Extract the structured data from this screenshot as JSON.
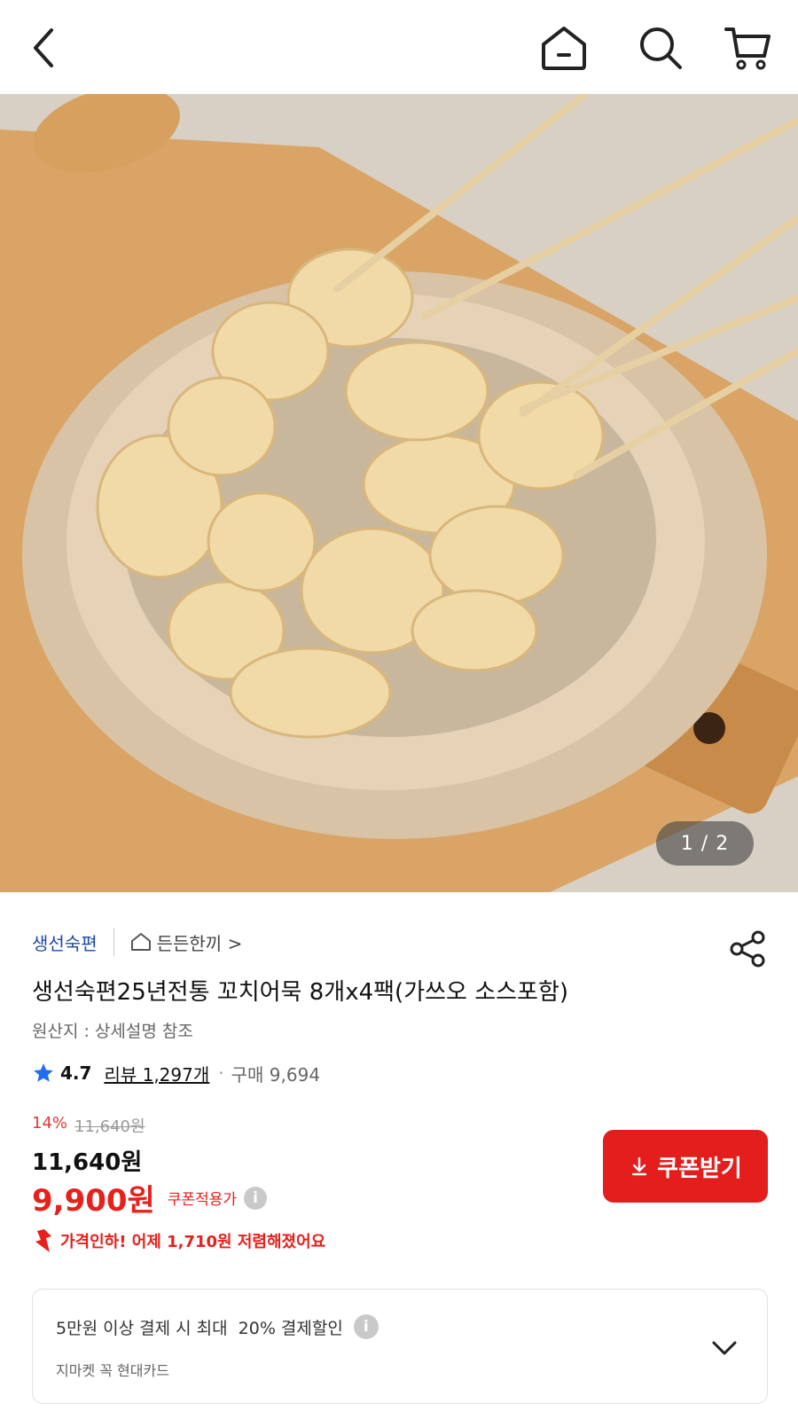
{
  "topbar": {
    "icons": [
      "back-icon",
      "home-icon",
      "search-icon",
      "cart-icon"
    ]
  },
  "hero": {
    "pager": "1 / 2"
  },
  "product": {
    "seller": "생선숙편",
    "store_link": "든든한끼 >",
    "title": "생선숙편25년전통 꼬치어묵 8개x4팩(가쓰오 소스포함)",
    "origin": "원산지 : 상세설명 참조",
    "rating": "4.7",
    "reviews": "리뷰 1,297개",
    "separator": "·",
    "purchases": "구매 9,694",
    "discount_rate": "14%",
    "original_price": "11,640원",
    "price": "11,640원",
    "sale_price": "9,900원",
    "coupon_note": "쿠폰적용가",
    "coupon_button": "쿠폰받기",
    "price_drop": "가격인하! 어제 1,710원 저렴해졌어요"
  },
  "card_offer": {
    "line1": "5만원 이상 결제 시 최대  20% 결제할인",
    "line2": "지마켓 꼭 현대카드"
  },
  "colors": {
    "accent_red": "#e8201b",
    "seller_blue": "#1d4aa6",
    "star_blue": "#1f6ff0"
  }
}
